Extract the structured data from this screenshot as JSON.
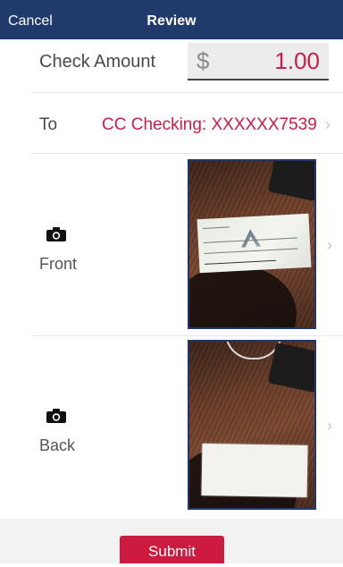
{
  "nav": {
    "cancel_label": "Cancel",
    "title": "Review"
  },
  "amount": {
    "label": "Check Amount",
    "currency_symbol": "$",
    "value": "1.00"
  },
  "deposit_to": {
    "label": "To",
    "account": "CC Checking: XXXXXX7539"
  },
  "front": {
    "label": "Front",
    "icon": "camera-icon"
  },
  "back": {
    "label": "Back",
    "icon": "camera-icon"
  },
  "submit_label": "Submit",
  "colors": {
    "nav_background": "#1f3a6b",
    "accent": "#cc1b4a",
    "submit_background": "#cc1b3f",
    "photo_border": "#23366a"
  }
}
